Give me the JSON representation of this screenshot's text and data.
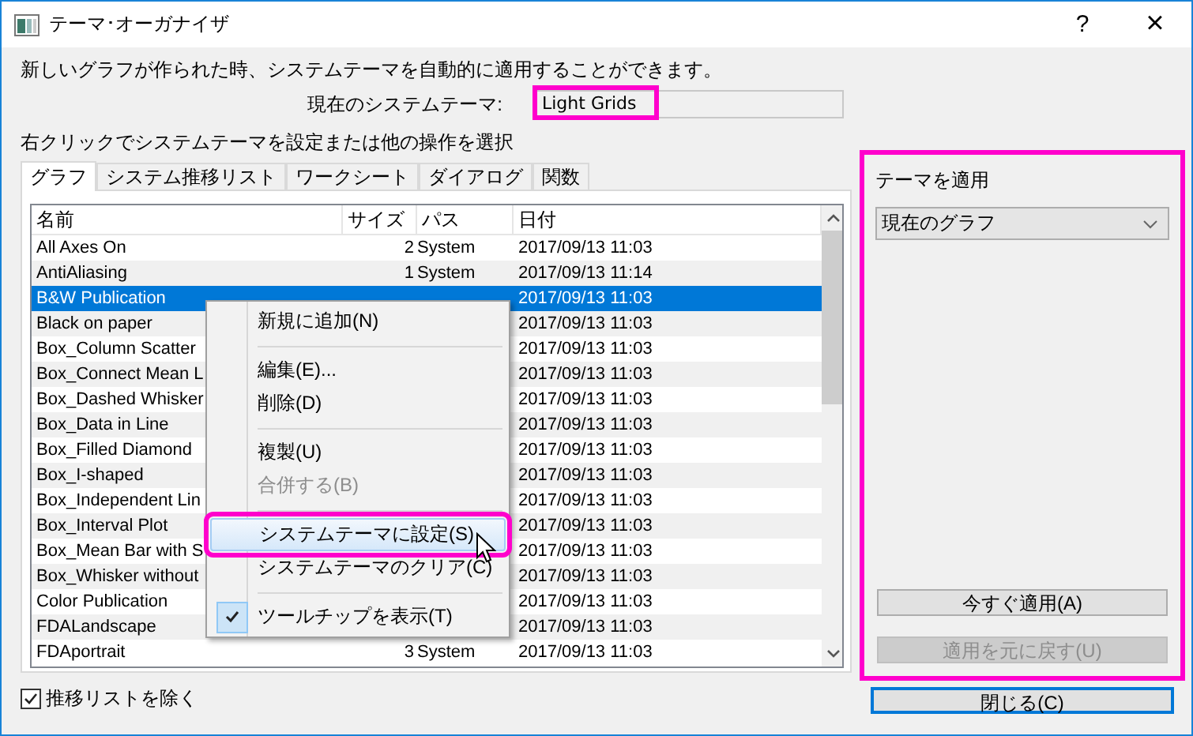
{
  "window": {
    "title": "テーマ･オーガナイザ",
    "help": "?",
    "close": "×"
  },
  "intro": "新しいグラフが作られた時、システムテーマを自動的に適用することができます。",
  "current_theme": {
    "label": "現在のシステムテーマ:",
    "value": "Light Grids"
  },
  "hint": "右クリックでシステムテーマを設定または他の操作を選択",
  "tabs": [
    {
      "label": "グラフ",
      "selected": true
    },
    {
      "label": "システム推移リスト",
      "selected": false
    },
    {
      "label": "ワークシート",
      "selected": false
    },
    {
      "label": "ダイアログ",
      "selected": false
    },
    {
      "label": "関数",
      "selected": false
    }
  ],
  "table": {
    "columns": [
      "名前",
      "サイズ",
      "パス",
      "日付"
    ],
    "rows": [
      {
        "name": "All Axes On",
        "size": "2",
        "path": "System",
        "date": "2017/09/13 11:03",
        "selected": false
      },
      {
        "name": "AntiAliasing",
        "size": "1",
        "path": "System",
        "date": "2017/09/13 11:14",
        "selected": false
      },
      {
        "name": "B&W Publication",
        "date": "2017/09/13 11:03",
        "selected": true
      },
      {
        "name": "Black on paper",
        "date": "2017/09/13 11:03",
        "selected": false
      },
      {
        "name": "Box_Column Scatter",
        "date": "2017/09/13 11:03",
        "selected": false
      },
      {
        "name": "Box_Connect Mean L",
        "date": "2017/09/13 11:03",
        "selected": false
      },
      {
        "name": "Box_Dashed Whisker",
        "date": "2017/09/13 11:03",
        "selected": false
      },
      {
        "name": "Box_Data in Line",
        "date": "2017/09/13 11:03",
        "selected": false
      },
      {
        "name": "Box_Filled Diamond",
        "date": "2017/09/13 11:03",
        "selected": false
      },
      {
        "name": "Box_I-shaped",
        "date": "2017/09/13 11:03",
        "selected": false
      },
      {
        "name": "Box_Independent Lin",
        "date": "2017/09/13 11:03",
        "selected": false
      },
      {
        "name": "Box_Interval Plot",
        "date": "2017/09/13 11:03",
        "selected": false
      },
      {
        "name": "Box_Mean Bar with S",
        "date": "2017/09/13 11:03",
        "selected": false
      },
      {
        "name": "Box_Whisker without",
        "date": "2017/09/13 11:03",
        "selected": false
      },
      {
        "name": "Color Publication",
        "date": "2017/09/13 11:03",
        "selected": false
      },
      {
        "name": "FDALandscape",
        "date": "2017/09/13 11:03",
        "selected": false
      },
      {
        "name": "FDAportrait",
        "size": "3",
        "path": "System",
        "date": "2017/09/13 11:03",
        "selected": false
      }
    ]
  },
  "context_menu": [
    {
      "kind": "item",
      "label": "新規に追加(N)",
      "disabled": false,
      "selected": false,
      "checked": false
    },
    {
      "kind": "separator"
    },
    {
      "kind": "item",
      "label": "編集(E)...",
      "disabled": false,
      "selected": false,
      "checked": false
    },
    {
      "kind": "item",
      "label": "削除(D)",
      "disabled": false,
      "selected": false,
      "checked": false
    },
    {
      "kind": "separator"
    },
    {
      "kind": "item",
      "label": "複製(U)",
      "disabled": false,
      "selected": false,
      "checked": false
    },
    {
      "kind": "item",
      "label": "合併する(B)",
      "disabled": true,
      "selected": false,
      "checked": false
    },
    {
      "kind": "separator"
    },
    {
      "kind": "item",
      "label": "システムテーマに設定(S)",
      "disabled": false,
      "selected": true,
      "checked": false
    },
    {
      "kind": "item",
      "label": "システムテーマのクリア(C)",
      "disabled": false,
      "selected": false,
      "checked": false
    },
    {
      "kind": "separator"
    },
    {
      "kind": "item",
      "label": "ツールチップを表示(T)",
      "disabled": false,
      "selected": false,
      "checked": true
    }
  ],
  "exclude_checkbox": {
    "label": "推移リストを除く",
    "checked": true
  },
  "apply_panel": {
    "title": "テーマを適用",
    "dropdown": "現在のグラフ",
    "buttons": [
      {
        "label": "今すぐ適用(A)",
        "disabled": false
      },
      {
        "label": "適用を元に戻す(U)",
        "disabled": true
      }
    ]
  },
  "close_button": "閉じる(C)"
}
